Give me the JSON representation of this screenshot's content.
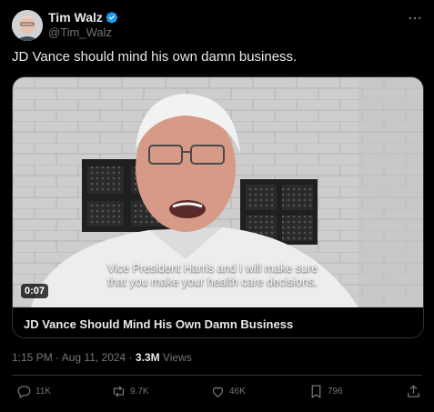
{
  "author": {
    "display_name": "Tim Walz",
    "handle": "@Tim_Walz",
    "verified": true
  },
  "tweet": {
    "text": "JD Vance should mind his own damn business."
  },
  "video": {
    "duration": "0:07",
    "caption_line1": "Vice President Harris and I will make sure",
    "caption_line2": "that you make your health care decisions.",
    "card_title": "JD Vance Should Mind His Own Damn Business"
  },
  "meta": {
    "time": "1:15 PM",
    "separator": " · ",
    "date": "Aug 11, 2024",
    "views_count": "3.3M",
    "views_label": " Views"
  },
  "actions": {
    "replies": "11K",
    "reposts": "9.7K",
    "likes": "46K",
    "bookmarks": "796"
  },
  "colors": {
    "background": "#000000",
    "text": "#e7e9ea",
    "muted": "#71767b",
    "verified": "#1d9bf0",
    "border": "#2f3336"
  }
}
